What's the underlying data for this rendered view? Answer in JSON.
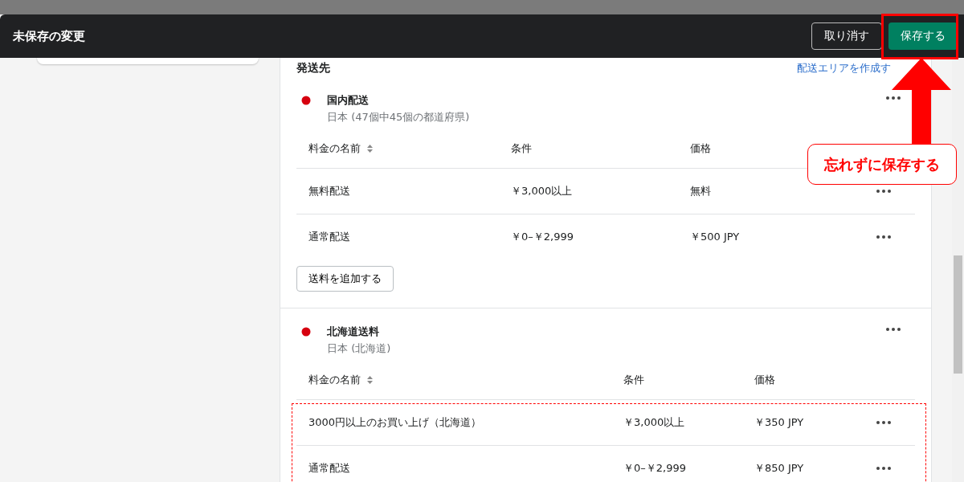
{
  "save_bar": {
    "title": "未保存の変更",
    "discard": "取り消す",
    "save": "保存する"
  },
  "shipping": {
    "title": "発送先",
    "create_link": "配送エリアを作成す",
    "zones": [
      {
        "name": "国内配送",
        "subtitle": "日本 (47個中45個の都道府県)",
        "columns": [
          "料金の名前",
          "条件",
          "価格"
        ],
        "highlighted": false,
        "add_button": "送料を追加する",
        "rows": [
          {
            "name": "無料配送",
            "condition": "￥3,000以上",
            "price": "無料"
          },
          {
            "name": "通常配送",
            "condition": "￥0–￥2,999",
            "price": "￥500 JPY"
          }
        ]
      },
      {
        "name": "北海道送料",
        "subtitle": "日本 (北海道)",
        "columns": [
          "料金の名前",
          "条件",
          "価格"
        ],
        "highlighted": true,
        "rows": [
          {
            "name": "3000円以上のお買い上げ（北海道）",
            "condition": "￥3,000以上",
            "price": "￥350 JPY"
          },
          {
            "name": "通常配送",
            "condition": "￥0–￥2,999",
            "price": "￥850 JPY"
          }
        ]
      }
    ]
  },
  "annotation": {
    "callout": "忘れずに保存する",
    "save_highlighted": true
  }
}
